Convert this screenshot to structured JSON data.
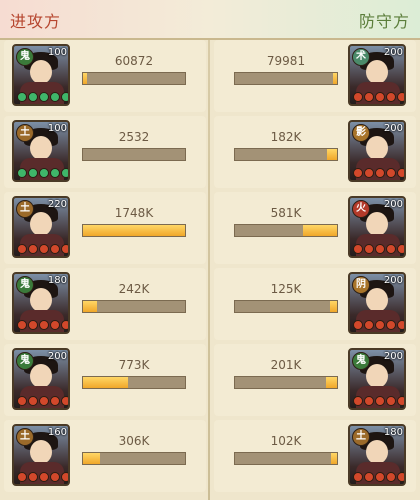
{
  "header": {
    "attack_label": "进攻方",
    "defense_label": "防守方"
  },
  "colors": {
    "faction_green": "#3b7a3a",
    "faction_red": "#b33a2a",
    "faction_purple": "#6d3b87",
    "pip_green": "#3fb56a",
    "pip_red": "#d2482b",
    "bar_fill": "#f0a72a",
    "bar_track": "#a39276"
  },
  "rows": [
    {
      "left": {
        "faction": "鬼",
        "faction_color": "#3b7a3a",
        "level": "100",
        "pip_color": "#3fb56a",
        "value": "60872",
        "fill": 0.03
      },
      "right": {
        "faction": "术",
        "faction_color": "#4b8a6a",
        "level": "200",
        "pip_color": "#d2482b",
        "value": "79981",
        "fill": 0.03
      }
    },
    {
      "left": {
        "faction": "土",
        "faction_color": "#9b6a2a",
        "level": "100",
        "pip_color": "#3fb56a",
        "value": "2532",
        "fill": 0.0
      },
      "right": {
        "faction": "影",
        "faction_color": "#a8742a",
        "level": "200",
        "pip_color": "#d2482b",
        "value": "182K",
        "fill": 0.1
      }
    },
    {
      "left": {
        "faction": "土",
        "faction_color": "#9b6a2a",
        "level": "220",
        "pip_color": "#d2482b",
        "value": "1748K",
        "fill": 1.0
      },
      "right": {
        "faction": "火",
        "faction_color": "#b33a2a",
        "level": "200",
        "pip_color": "#d2482b",
        "value": "581K",
        "fill": 0.33
      }
    },
    {
      "left": {
        "faction": "鬼",
        "faction_color": "#3b7a3a",
        "level": "180",
        "pip_color": "#d2482b",
        "value": "242K",
        "fill": 0.14
      },
      "right": {
        "faction": "阴",
        "faction_color": "#a8742a",
        "level": "200",
        "pip_color": "#d2482b",
        "value": "125K",
        "fill": 0.07
      }
    },
    {
      "left": {
        "faction": "鬼",
        "faction_color": "#3b7a3a",
        "level": "200",
        "pip_color": "#d2482b",
        "value": "773K",
        "fill": 0.44
      },
      "right": {
        "faction": "鬼",
        "faction_color": "#3b7a3a",
        "level": "200",
        "pip_color": "#d2482b",
        "value": "201K",
        "fill": 0.11
      }
    },
    {
      "left": {
        "faction": "土",
        "faction_color": "#9b6a2a",
        "level": "160",
        "pip_color": "#d2482b",
        "value": "306K",
        "fill": 0.17
      },
      "right": {
        "faction": "土",
        "faction_color": "#9b6a2a",
        "level": "180",
        "pip_color": "#d2482b",
        "value": "102K",
        "fill": 0.06
      }
    }
  ]
}
